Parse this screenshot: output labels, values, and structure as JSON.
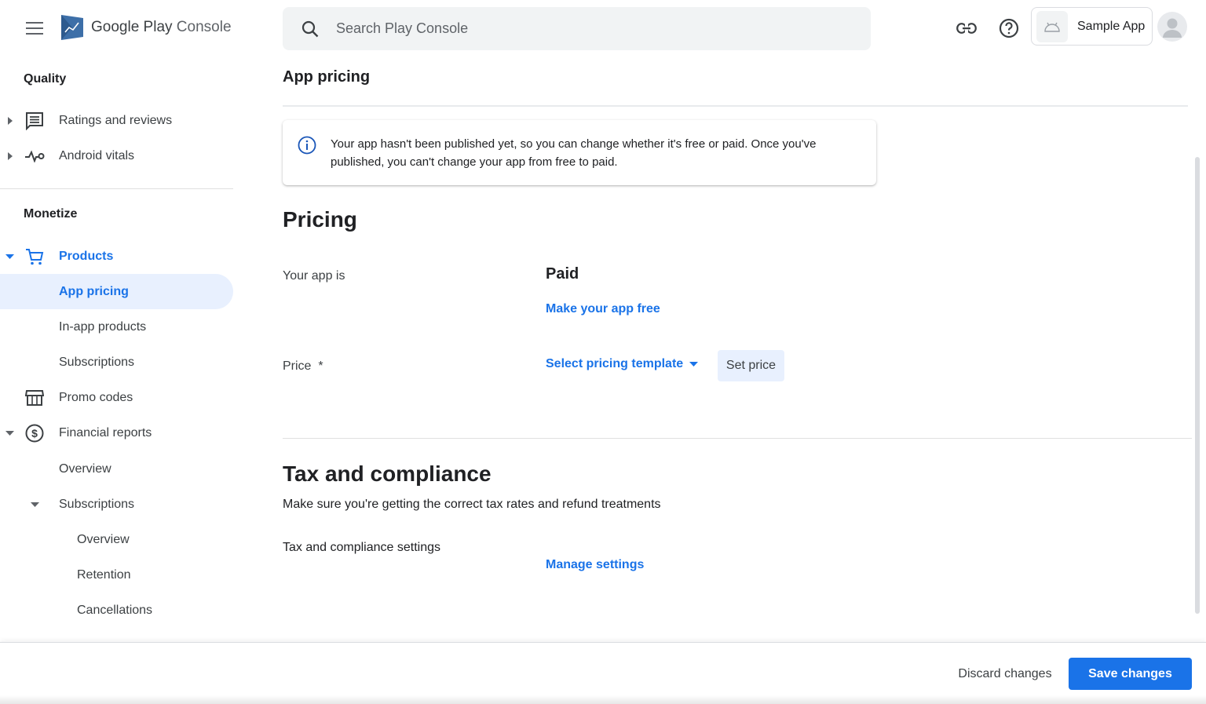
{
  "header": {
    "logo_text_brand": "Google Play",
    "logo_text_product": "Console",
    "search_placeholder": "Search Play Console",
    "app_name": "Sample App"
  },
  "sidebar": {
    "sections": [
      {
        "title": "Quality"
      },
      {
        "title": "Monetize"
      }
    ],
    "items": [
      {
        "label": "Ratings and reviews",
        "icon": "reviews-icon"
      },
      {
        "label": "Android vitals",
        "icon": "vitals-icon"
      },
      {
        "label": "Products",
        "icon": "cart-icon"
      },
      {
        "label": "App pricing"
      },
      {
        "label": "In-app products"
      },
      {
        "label": "Subscriptions"
      },
      {
        "label": "Promo codes",
        "icon": "store-icon"
      },
      {
        "label": "Financial reports",
        "icon": "dollar-icon"
      },
      {
        "label": "Overview"
      },
      {
        "label": "Subscriptions"
      },
      {
        "label": "Overview"
      },
      {
        "label": "Retention"
      },
      {
        "label": "Cancellations"
      }
    ]
  },
  "main": {
    "page_title": "App pricing",
    "info_message": "Your app hasn't been published yet, so you can change whether it's free or paid. Once you've published, you can't change your app from free to paid.",
    "pricing": {
      "heading": "Pricing",
      "your_app_label": "Your app is",
      "your_app_value": "Paid",
      "make_free_link": "Make your app free",
      "price_label": "Price  *",
      "template_select": "Select pricing template",
      "set_price_button": "Set price"
    },
    "tax": {
      "heading": "Tax and compliance",
      "description": "Make sure you're getting the correct tax rates and refund treatments",
      "settings_label": "Tax and compliance settings",
      "manage_link": "Manage settings"
    }
  },
  "footer": {
    "discard_label": "Discard changes",
    "save_label": "Save changes"
  },
  "colors": {
    "accent": "#1a73e8",
    "active_bg": "#e8f0fe"
  }
}
